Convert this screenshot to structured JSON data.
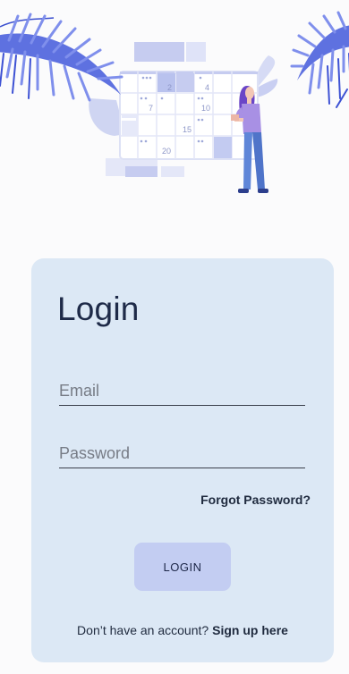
{
  "login": {
    "title": "Login",
    "email_placeholder": "Email",
    "password_placeholder": "Password",
    "forgot_label": "Forgot Password?",
    "login_button_label": "LOGIN",
    "no_account_text": "Don’t have an account?",
    "signup_link_label": "Sign up here"
  },
  "illustration": {
    "calendar_numbers": [
      "2",
      "4",
      "7",
      "10",
      "15",
      "20"
    ]
  },
  "colors": {
    "card_bg": "#dce8f5",
    "button_bg": "#c3cdf2",
    "accent_purple": "#8f7bd9",
    "leaf_blue": "#5a6fe0"
  }
}
